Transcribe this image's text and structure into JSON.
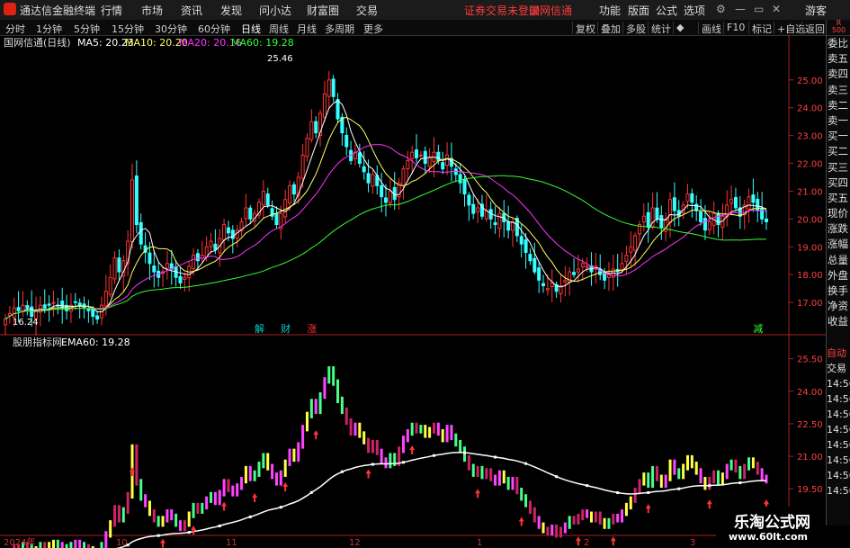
{
  "topbar": {
    "app_title": "通达信金融终端",
    "menus": [
      "行情",
      "市场",
      "资讯",
      "发现",
      "问小达",
      "财富圈",
      "交易"
    ],
    "login_warning": "证券交易未登录",
    "stock_name": "国网信通",
    "right_menus": [
      "功能",
      "版面",
      "公式",
      "选项"
    ],
    "user": "游客"
  },
  "toolbar": {
    "periods": [
      "分时",
      "1分钟",
      "5分钟",
      "15分钟",
      "30分钟",
      "60分钟",
      "日线",
      "周线",
      "月线",
      "多周期",
      "更多"
    ],
    "selected_period": "日线",
    "buttons": [
      "复权",
      "叠加",
      "多股",
      "统计",
      "画线",
      "F10",
      "标记",
      "+自选",
      "返回"
    ]
  },
  "main_panel": {
    "title": "国网信通(日线)",
    "ma_labels": [
      {
        "label": "MA5: 20.23",
        "color": "#ffffff"
      },
      {
        "label": "MA10: 20.20",
        "color": "#ffff66"
      },
      {
        "label": "MA20: 20.16",
        "color": "#ff33ff"
      },
      {
        "label": "MA60: 19.28",
        "color": "#33ff33"
      }
    ],
    "max_label": "25.46",
    "min_label": "16.24",
    "events": [
      {
        "text": "解",
        "color": "#00cccc",
        "index": 58
      },
      {
        "text": "财",
        "color": "#00cccc",
        "index": 64
      },
      {
        "text": "涨",
        "color": "#ff3333",
        "index": 70
      },
      {
        "text": "减",
        "color": "#33ff33",
        "index": 172
      }
    ]
  },
  "sub_panel": {
    "title": "股朋指标网",
    "ema_label": "EMA60: 19.28"
  },
  "side_labels": [
    "委比",
    "卖五",
    "卖四",
    "卖三",
    "卖二",
    "卖一",
    "买一",
    "买二",
    "买三",
    "买四",
    "买五",
    "现价",
    "涨跌",
    "涨幅",
    "总量",
    "外盘",
    "换手",
    "净资",
    "收益"
  ],
  "side_labels2": [
    "自动",
    "交易",
    "14:56",
    "14:56",
    "14:56",
    "14:56",
    "14:56",
    "14:56",
    "14:56",
    "14:56"
  ],
  "corner": {
    "top": "R",
    "bottom": "500"
  },
  "x_axis_labels": [
    "2024年",
    "10",
    "11",
    "12",
    "1",
    "2",
    "3"
  ],
  "watermark": {
    "title": "乐淘公式网",
    "url": "www.60lt.com"
  },
  "chart_data": [
    {
      "type": "candlestick",
      "title": "国网信通(日线)",
      "ylim": [
        16.0,
        25.9
      ],
      "y_ticks": [
        17.0,
        18.0,
        19.0,
        20.0,
        21.0,
        22.0,
        23.0,
        24.0,
        25.0
      ],
      "up_color": "#ff3333",
      "down_color": "#33ffff",
      "closes": [
        16.4,
        16.6,
        16.8,
        16.7,
        16.9,
        16.8,
        16.5,
        16.7,
        16.9,
        16.8,
        16.9,
        17.0,
        16.9,
        16.8,
        16.7,
        16.9,
        17.0,
        16.9,
        16.8,
        16.7,
        16.5,
        16.4,
        16.9,
        17.4,
        17.9,
        18.6,
        18.1,
        18.5,
        19.2,
        21.4,
        19.8,
        19.1,
        18.8,
        18.4,
        18.1,
        17.9,
        18.1,
        18.4,
        18.2,
        17.9,
        17.7,
        17.9,
        18.3,
        18.7,
        18.5,
        18.7,
        19.0,
        19.2,
        18.9,
        19.3,
        19.8,
        19.5,
        19.3,
        19.6,
        19.9,
        20.4,
        20.0,
        20.2,
        20.6,
        21.0,
        20.5,
        20.1,
        19.8,
        20.2,
        20.7,
        21.2,
        20.9,
        21.5,
        22.3,
        22.9,
        23.5,
        23.1,
        23.8,
        24.5,
        25.0,
        24.4,
        23.6,
        23.1,
        22.6,
        22.1,
        22.4,
        22.0,
        21.7,
        21.3,
        21.6,
        21.2,
        20.8,
        20.6,
        21.0,
        20.7,
        21.3,
        21.8,
        22.1,
        22.4,
        22.2,
        22.3,
        22.0,
        22.2,
        22.4,
        22.1,
        21.8,
        22.3,
        21.9,
        21.6,
        21.3,
        20.9,
        20.5,
        20.2,
        20.4,
        20.1,
        20.3,
        20.0,
        19.8,
        20.2,
        19.9,
        19.6,
        19.9,
        19.4,
        19.1,
        18.8,
        18.5,
        18.1,
        17.8,
        17.6,
        17.5,
        17.7,
        17.4,
        17.6,
        17.8,
        18.1,
        18.0,
        18.2,
        18.4,
        18.3,
        18.1,
        18.3,
        18.0,
        17.8,
        18.0,
        18.2,
        18.1,
        18.4,
        18.7,
        19.0,
        19.4,
        19.8,
        20.1,
        19.7,
        20.4,
        20.0,
        19.7,
        20.0,
        20.7,
        20.3,
        20.1,
        20.5,
        20.9,
        20.6,
        20.3,
        19.9,
        19.6,
        19.9,
        20.2,
        19.8,
        20.1,
        20.5,
        20.7,
        20.4,
        20.1,
        20.5,
        20.8,
        20.6,
        20.3,
        20.0,
        19.9
      ],
      "ma_series": [
        {
          "name": "MA5",
          "color": "#ffffff",
          "period": 5
        },
        {
          "name": "MA10",
          "color": "#ffff66",
          "period": 10
        },
        {
          "name": "MA20",
          "color": "#ff33ff",
          "period": 20
        },
        {
          "name": "MA60",
          "color": "#33ff33",
          "period": 60
        }
      ]
    },
    {
      "type": "bar",
      "title": "股朋指标网",
      "ylim": [
        17.6,
        25.9
      ],
      "y_ticks": [
        18.0,
        19.5,
        21.0,
        22.5,
        24.0,
        25.5
      ],
      "ema_series": {
        "name": "EMA60",
        "color": "#ffffff",
        "period": 60
      },
      "signal_arrows": [
        8,
        15,
        22,
        29,
        36,
        43,
        50,
        57,
        64,
        71,
        83,
        93,
        108,
        118,
        131,
        139,
        147,
        161,
        175,
        189
      ],
      "palette": [
        "#ff44ff",
        "#44ff88",
        "#ffff44",
        "#cc2266"
      ]
    }
  ]
}
